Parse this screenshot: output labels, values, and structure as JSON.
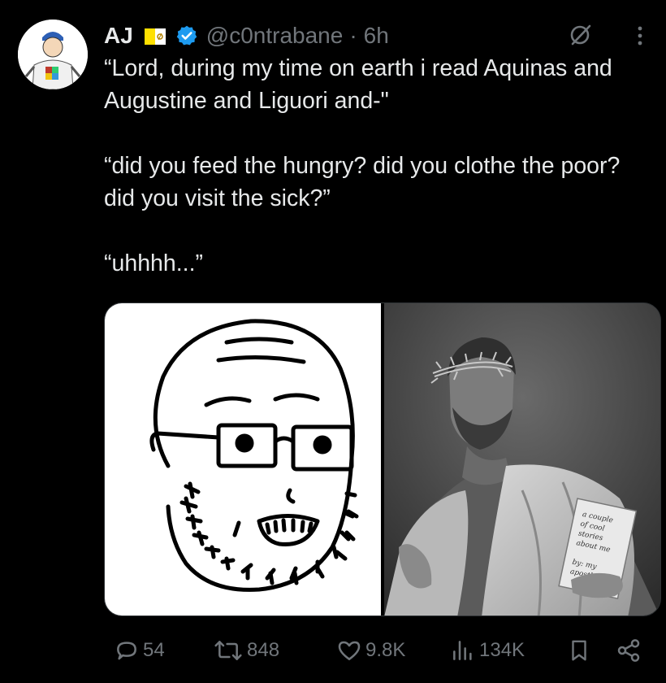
{
  "post": {
    "author": {
      "name": "AJ",
      "handle": "@c0ntrabane",
      "separator": "·",
      "time": "6h",
      "verified": true,
      "badges": [
        "vatican-flag-icon",
        "verified-badge-icon"
      ]
    },
    "text": {
      "para1": "“Lord, during my time on earth i read Aquinas and Augustine and Liguori and-\"",
      "para2": "“did you feed the hungry? did you clothe the poor? did you visit the sick?”",
      "para3": "“uhhhh...”"
    },
    "media": {
      "left_image": "soyjak-glasses-drawing",
      "right_image": "gigachad-jesus-photo",
      "book_text": [
        "a couple",
        "of cool",
        "stories",
        "about me",
        "by: my",
        "apostles"
      ]
    },
    "actions": {
      "replies": "54",
      "reposts": "848",
      "likes": "9.8K",
      "views": "134K"
    },
    "colors": {
      "background": "#000000",
      "text": "#e7e9ea",
      "muted": "#71767b",
      "verified": "#1d9bf0"
    }
  }
}
